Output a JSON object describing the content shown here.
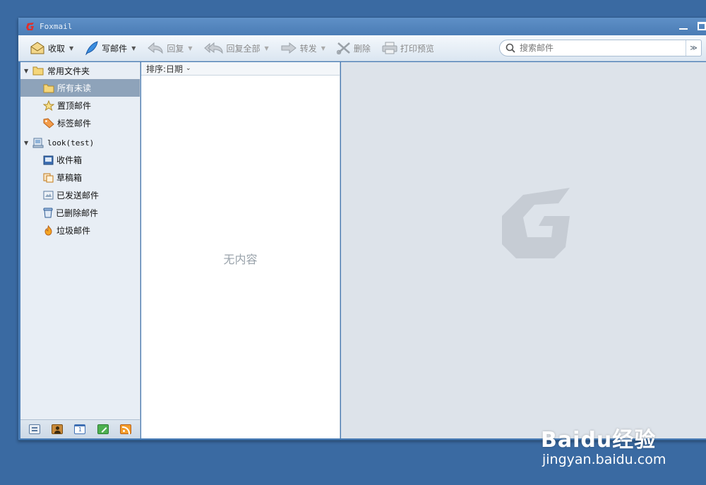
{
  "window": {
    "title": "Foxmail"
  },
  "toolbar": {
    "receive": "收取",
    "compose": "写邮件",
    "reply": "回复",
    "reply_all": "回复全部",
    "forward": "转发",
    "delete": "删除",
    "print_preview": "打印预览"
  },
  "search": {
    "placeholder": "搜索邮件"
  },
  "sidebar": {
    "common_group": "常用文件夹",
    "common_items": [
      {
        "label": "所有未读"
      },
      {
        "label": "置顶邮件"
      },
      {
        "label": "标签邮件"
      }
    ],
    "account_group": "look(test)",
    "account_items": [
      {
        "label": "收件箱"
      },
      {
        "label": "草稿箱"
      },
      {
        "label": "已发送邮件"
      },
      {
        "label": "已删除邮件"
      },
      {
        "label": "垃圾邮件"
      }
    ]
  },
  "list": {
    "sort_label": "排序:日期",
    "empty_text": "无内容"
  },
  "watermark": {
    "brand": "Baidu经验",
    "url": "jingyan.baidu.com"
  },
  "colors": {
    "desktop": "#3a6aa2",
    "selected_folder": "#8ea3ba",
    "preview_bg": "#dde3ea"
  }
}
